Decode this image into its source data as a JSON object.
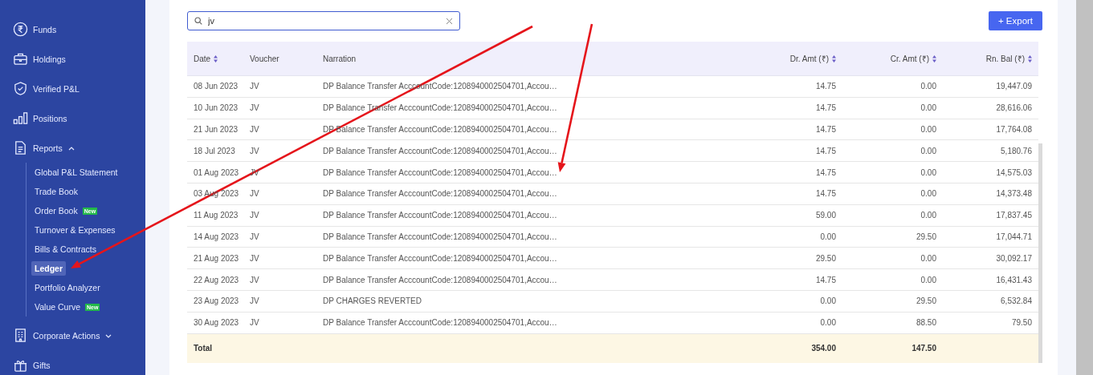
{
  "sidebar": {
    "items": [
      {
        "label": "Funds"
      },
      {
        "label": "Holdings"
      },
      {
        "label": "Verified P&L"
      },
      {
        "label": "Positions"
      },
      {
        "label": "Reports",
        "expanded": true,
        "children": [
          {
            "label": "Global P&L Statement",
            "selected": false
          },
          {
            "label": "Trade Book",
            "selected": false
          },
          {
            "label": "Order Book",
            "selected": false,
            "badge": "New"
          },
          {
            "label": "Turnover & Expenses",
            "selected": false
          },
          {
            "label": "Bills & Contracts",
            "selected": false
          },
          {
            "label": "Ledger",
            "selected": true
          },
          {
            "label": "Portfolio Analyzer",
            "selected": false
          },
          {
            "label": "Value Curve",
            "selected": false,
            "badge": "New"
          }
        ]
      },
      {
        "label": "Corporate Actions",
        "expanded": false
      },
      {
        "label": "Gifts"
      }
    ]
  },
  "search": {
    "value": "jv"
  },
  "export_button": "+ Export",
  "table": {
    "columns": [
      {
        "label": "Date",
        "sortable": true
      },
      {
        "label": "Voucher",
        "sortable": false
      },
      {
        "label": "Narration",
        "sortable": false
      },
      {
        "label": "Dr. Amt (₹)",
        "sortable": true
      },
      {
        "label": "Cr. Amt (₹)",
        "sortable": true
      },
      {
        "label": "Rn. Bal (₹)",
        "sortable": true
      }
    ],
    "rows": [
      [
        "08 Jun 2023",
        "JV",
        "DP Balance Transfer AcccountCode:1208940002504701,Accou…",
        "14.75",
        "0.00",
        "19,447.09"
      ],
      [
        "10 Jun 2023",
        "JV",
        "DP Balance Transfer AcccountCode:1208940002504701,Accou…",
        "14.75",
        "0.00",
        "28,616.06"
      ],
      [
        "21 Jun 2023",
        "JV",
        "DP Balance Transfer AcccountCode:1208940002504701,Accou…",
        "14.75",
        "0.00",
        "17,764.08"
      ],
      [
        "18 Jul 2023",
        "JV",
        "DP Balance Transfer AcccountCode:1208940002504701,Accou…",
        "14.75",
        "0.00",
        "5,180.76"
      ],
      [
        "01 Aug 2023",
        "JV",
        "DP Balance Transfer AcccountCode:1208940002504701,Accou…",
        "14.75",
        "0.00",
        "14,575.03"
      ],
      [
        "03 Aug 2023",
        "JV",
        "DP Balance Transfer AcccountCode:1208940002504701,Accou…",
        "14.75",
        "0.00",
        "14,373.48"
      ],
      [
        "11 Aug 2023",
        "JV",
        "DP Balance Transfer AcccountCode:1208940002504701,Accou…",
        "59.00",
        "0.00",
        "17,837.45"
      ],
      [
        "14 Aug 2023",
        "JV",
        "DP Balance Transfer AcccountCode:1208940002504701,Accou…",
        "0.00",
        "29.50",
        "17,044.71"
      ],
      [
        "21 Aug 2023",
        "JV",
        "DP Balance Transfer AcccountCode:1208940002504701,Accou…",
        "29.50",
        "0.00",
        "30,092.17"
      ],
      [
        "22 Aug 2023",
        "JV",
        "DP Balance Transfer AcccountCode:1208940002504701,Accou…",
        "14.75",
        "0.00",
        "16,431.43"
      ],
      [
        "23 Aug 2023",
        "JV",
        "DP CHARGES REVERTED",
        "0.00",
        "29.50",
        "6,532.84"
      ],
      [
        "30 Aug 2023",
        "JV",
        "DP Balance Transfer AcccountCode:1208940002504701,Accou…",
        "0.00",
        "88.50",
        "79.50"
      ]
    ],
    "total": {
      "label": "Total",
      "dr": "354.00",
      "cr": "147.50"
    }
  },
  "annotations": [
    {
      "kind": "arrow"
    },
    {
      "kind": "arrow"
    }
  ]
}
